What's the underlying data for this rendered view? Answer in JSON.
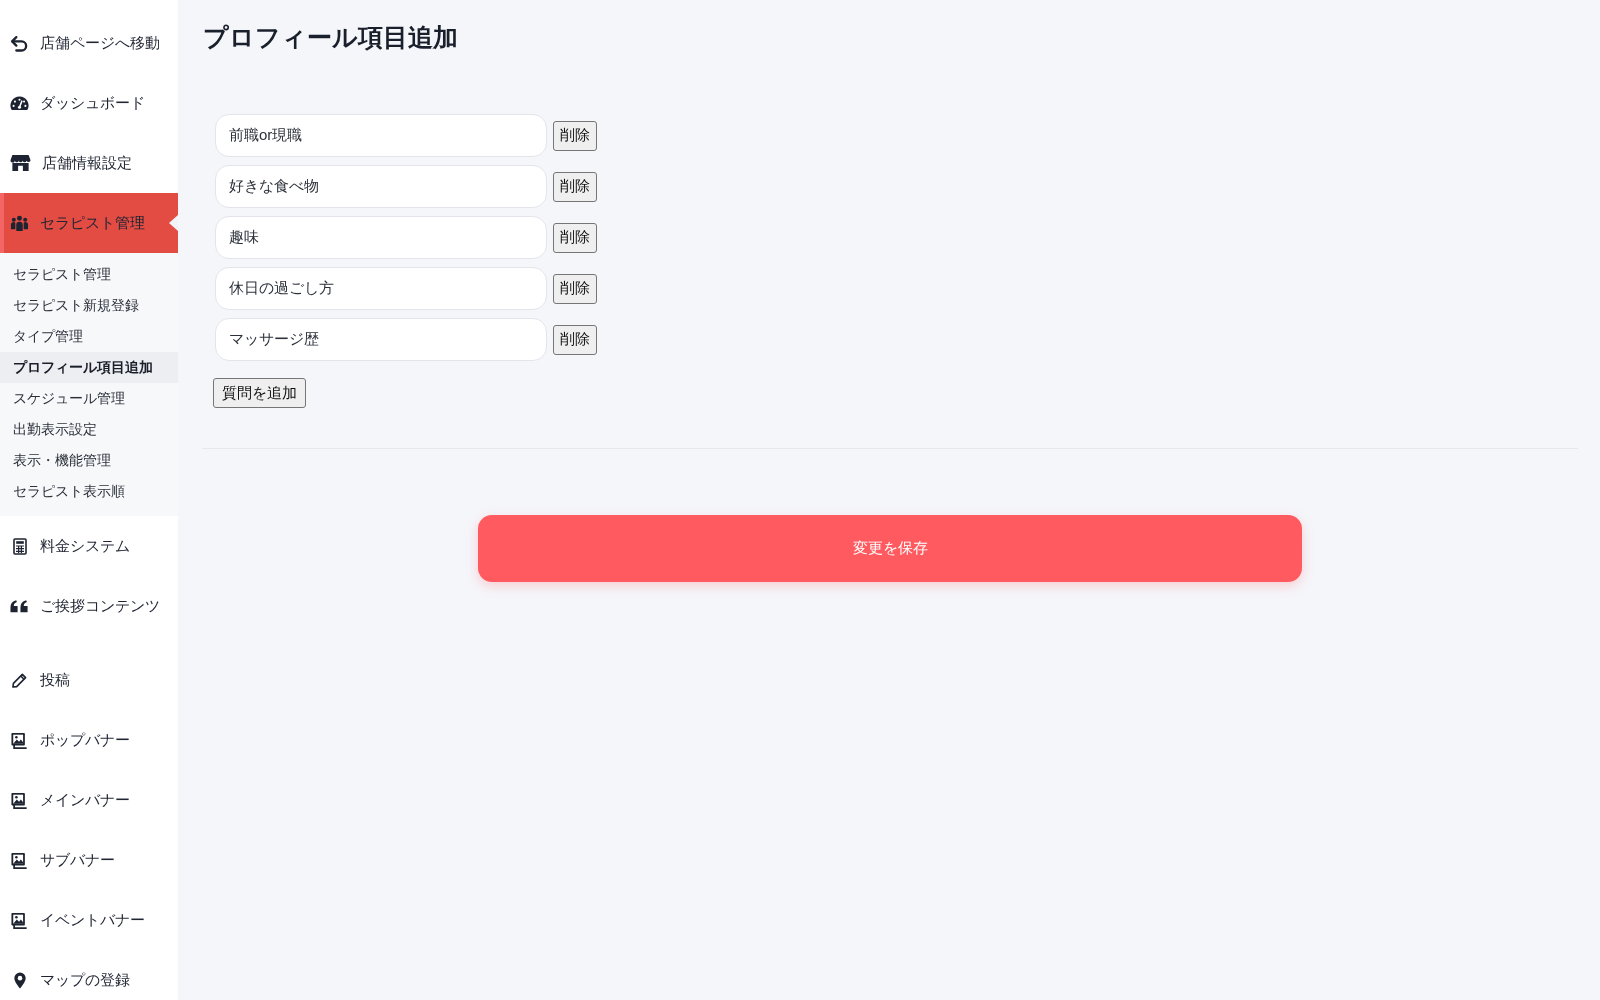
{
  "sidebar": {
    "items": [
      {
        "label": "店舗ページへ移動",
        "selected": false
      },
      {
        "label": "ダッシュボード",
        "selected": false
      },
      {
        "label": "店舗情報設定",
        "selected": false
      },
      {
        "label": "セラピスト管理",
        "selected": true,
        "children": [
          {
            "label": "セラピスト管理",
            "selected": false
          },
          {
            "label": "セラピスト新規登録",
            "selected": false
          },
          {
            "label": "タイプ管理",
            "selected": false
          },
          {
            "label": "プロフィール項目追加",
            "selected": true
          },
          {
            "label": "スケジュール管理",
            "selected": false
          },
          {
            "label": "出勤表示設定",
            "selected": false
          },
          {
            "label": "表示・機能管理",
            "selected": false
          },
          {
            "label": "セラピスト表示順",
            "selected": false
          }
        ]
      },
      {
        "label": "料金システム",
        "selected": false
      },
      {
        "label": "ご挨拶コンテンツ",
        "selected": false
      },
      {
        "label": "投稿",
        "selected": false
      },
      {
        "label": "ポップバナー",
        "selected": false
      },
      {
        "label": "メインバナー",
        "selected": false
      },
      {
        "label": "サブバナー",
        "selected": false
      },
      {
        "label": "イベントバナー",
        "selected": false
      },
      {
        "label": "マップの登録",
        "selected": false
      }
    ]
  },
  "page_title": "プロフィール項目追加",
  "questions": [
    {
      "value": "前職or現職",
      "delete_label": "削除"
    },
    {
      "value": "好きな食べ物",
      "delete_label": "削除"
    },
    {
      "value": "趣味",
      "delete_label": "削除"
    },
    {
      "value": "休日の過ごし方",
      "delete_label": "削除"
    },
    {
      "value": "マッサージ歴",
      "delete_label": "削除"
    }
  ],
  "add_button": "質問を追加",
  "save_button": "変更を保存"
}
